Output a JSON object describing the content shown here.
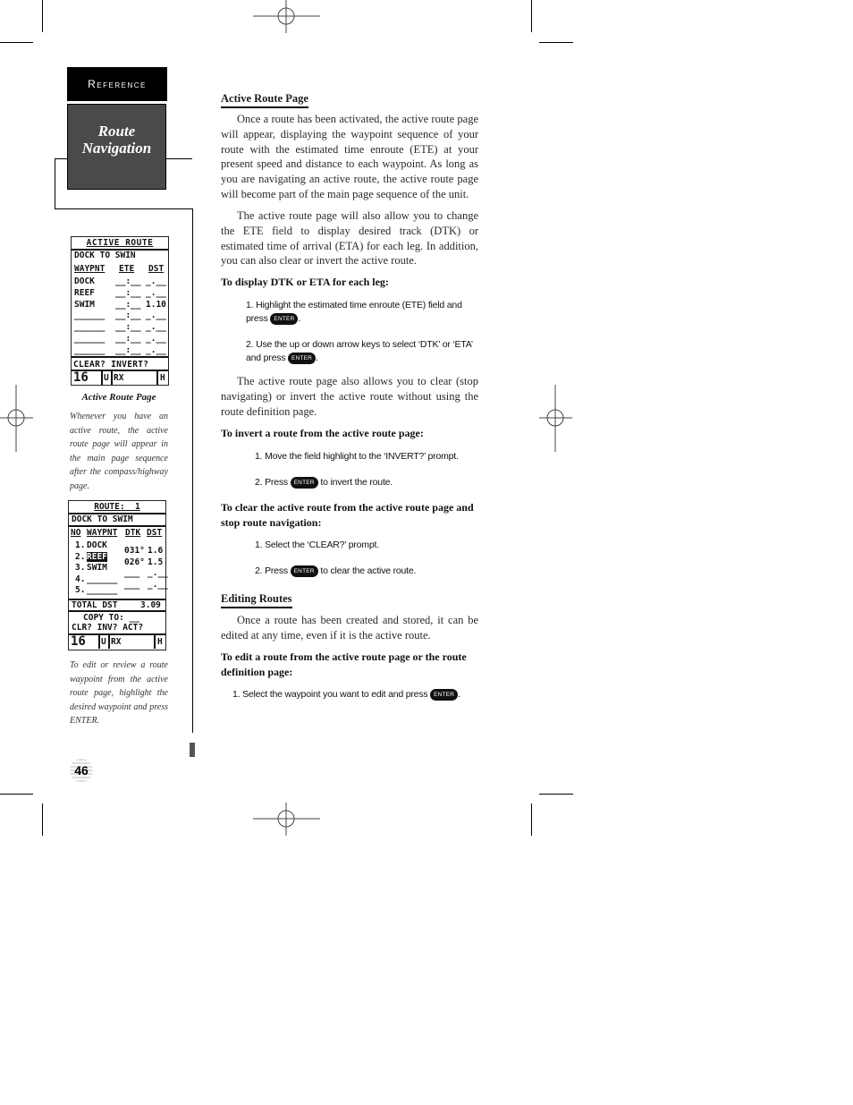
{
  "sidebar": {
    "reference_label": "Reference",
    "section_title_line1": "Route",
    "section_title_line2": "Navigation",
    "figure1": {
      "caption_title": "Active Route Page",
      "caption_text": "Whenever you have an active route, the active route page will appear in the main page sequence after the compass/highway page.",
      "screen": {
        "title": "ACTIVE ROUTE",
        "route_name": "DOCK TO SWIN",
        "headers": [
          "WAYPNT",
          "ETE",
          "DST"
        ],
        "rows": [
          {
            "waypoint": "DOCK",
            "ete": "__:__",
            "dst": "_.__"
          },
          {
            "waypoint": "REEF",
            "ete": "__:__",
            "dst": "_.__"
          },
          {
            "waypoint": "SWIM",
            "ete": "__:__",
            "dst": "1.10"
          },
          {
            "waypoint": "______",
            "ete": "__:__",
            "dst": "_.__"
          },
          {
            "waypoint": "______",
            "ete": "__:__",
            "dst": "_.__"
          },
          {
            "waypoint": "______",
            "ete": "__:__",
            "dst": "_.__"
          },
          {
            "waypoint": "______",
            "ete": "__:__",
            "dst": "_.__"
          }
        ],
        "prompts": "CLEAR? INVERT?",
        "status": {
          "sat": "16",
          "mode": "U",
          "rx": "RX",
          "h": "H"
        }
      }
    },
    "figure2": {
      "caption_text": "To edit or review a route waypoint from the active route page, highlight the desired waypoint and press ENTER.",
      "screen": {
        "title": "ROUTE:  1",
        "route_name": "DOCK TO SWIM",
        "headers": [
          "NO",
          "WAYPNT",
          "DTK",
          "DST"
        ],
        "rows": [
          {
            "no": "1.",
            "waypoint": "DOCK"
          },
          {
            "no": "2.",
            "waypoint": "REEF",
            "highlighted": true
          },
          {
            "no": "3.",
            "waypoint": "SWIM"
          },
          {
            "no": "4.",
            "waypoint": "______"
          },
          {
            "no": "5.",
            "waypoint": "______"
          }
        ],
        "legs": [
          {
            "dtk": "031°",
            "dst": "1.6"
          },
          {
            "dtk": "026°",
            "dst": "1.5"
          },
          {
            "dtk": "___",
            "dst": "_.__"
          },
          {
            "dtk": "___",
            "dst": "_.__"
          }
        ],
        "total_label": "TOTAL DST",
        "total_value": "3.09",
        "copy_to": "COPY TO: __",
        "prompts": "CLR? INV? ACT?",
        "status": {
          "sat": "16",
          "mode": "U",
          "rx": "RX",
          "h": "H"
        }
      }
    }
  },
  "main": {
    "section1": {
      "heading": "Active Route Page",
      "para1": "Once a route has been activated, the active route page will appear, displaying the waypoint sequence of your route with the estimated time enroute (ETE) at your present speed and distance to each waypoint. As long as you are navigating an active route, the active route page will become part of the main page sequence of the unit.",
      "para2": "The active route page will also allow you to change the ETE field to display desired track (DTK) or estimated time of arrival (ETA) for each leg. In addition, you can also clear or invert the active route.",
      "sub1": "To display DTK or ETA for each leg:",
      "sub1_steps": [
        {
          "before": "1. Highlight the estimated time enroute (ETE) field and press",
          "after": "."
        },
        {
          "before": "2. Use the up or down arrow keys to select ‘DTK’ or ‘ETA’ and press",
          "after": "."
        }
      ],
      "para3": "The active route page also allows you to clear (stop navigating) or invert the active route without using the route definition page.",
      "sub2": "To invert a route from the active route page:",
      "sub2_steps": [
        {
          "before": "1. Move the field highlight to the ‘INVERT?’ prompt.",
          "after": ""
        },
        {
          "before": "2. Press",
          "after": "to invert the route."
        }
      ],
      "sub3": "To clear the active route from the active route page and stop route navigation:",
      "sub3_steps": [
        {
          "before": "1. Select the ‘CLEAR?’ prompt.",
          "after": ""
        },
        {
          "before": "2. Press",
          "after": "to clear the active route."
        }
      ]
    },
    "section2": {
      "heading": "Editing Routes",
      "para1": "Once a route has been created and stored, it can be edited at any time, even if it is the active route.",
      "sub1": "To edit a route from the active route page or the route definition page:",
      "sub1_steps": [
        {
          "before": "1. Select the waypoint you want to edit and press",
          "after": "."
        }
      ]
    },
    "enter_key_label": "ENTER"
  },
  "footer": {
    "page_number": "46"
  }
}
